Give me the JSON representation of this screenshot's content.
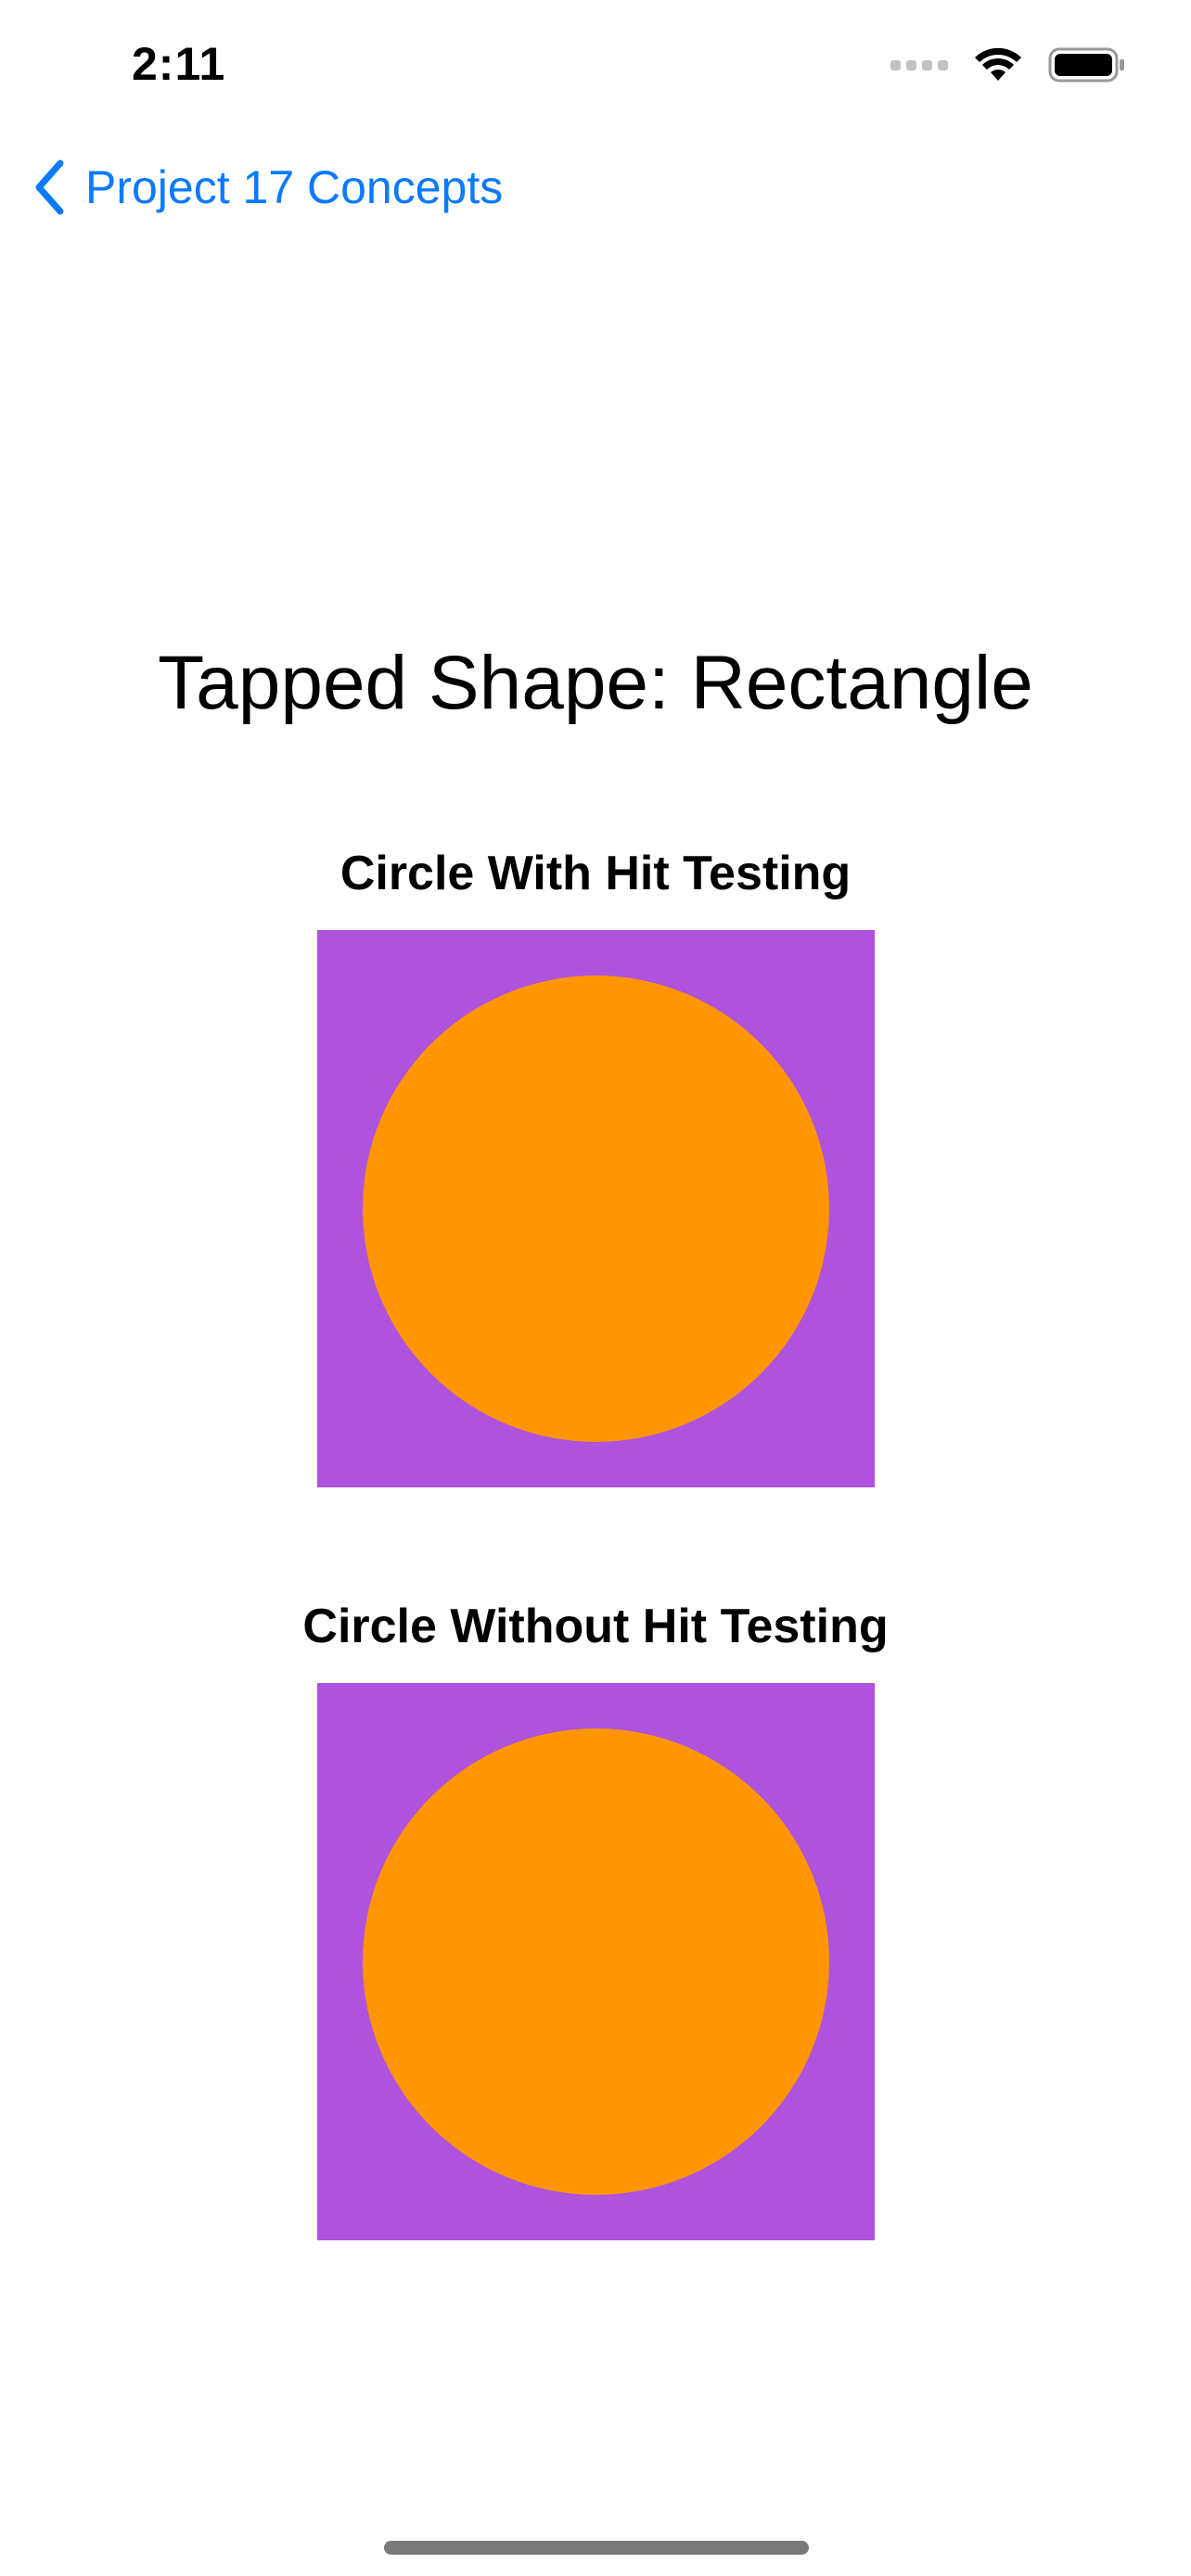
{
  "status_bar": {
    "time": "2:11"
  },
  "nav": {
    "back_label": "Project 17 Concepts"
  },
  "main": {
    "tapped_text": "Tapped Shape: Rectangle",
    "sections": [
      {
        "title": "Circle With Hit Testing"
      },
      {
        "title": "Circle Without Hit Testing"
      }
    ]
  },
  "colors": {
    "accent": "#0a7aff",
    "rectangle": "#af52de",
    "circle": "#ff9500"
  },
  "icons": {
    "back": "chevron-left-icon",
    "signal": "cellular-signal-icon",
    "wifi": "wifi-icon",
    "battery": "battery-icon"
  }
}
